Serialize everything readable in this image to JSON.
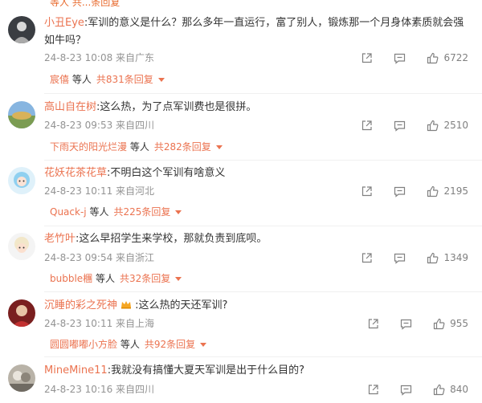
{
  "top_fragment": "等人 共...条回复",
  "comments": [
    {
      "user": "小丑Eye",
      "text": ":军训的意义是什么？那么多年一直运行，富了别人，锻炼那一个月身体素质就会强如牛吗？",
      "meta": "24-8-23 10:08 来自广东",
      "likes": "6722",
      "reply_user": "宸僖",
      "reply_mid": "等人",
      "reply_total": "共831条回复"
    },
    {
      "user": "高山自在树",
      "text": ":这么热，为了点军训费也是很拼。",
      "meta": "24-8-23 09:53 来自四川",
      "likes": "2510",
      "reply_user": "下雨天的阳光烂漫",
      "reply_mid": "等人",
      "reply_total": "共282条回复"
    },
    {
      "user": "花妖花茶花草",
      "text": ":不明白这个军训有啥意义",
      "meta": "24-8-23 10:11 来自河北",
      "likes": "2195",
      "reply_user": "Quack-j",
      "reply_mid": "等人",
      "reply_total": "共225条回复"
    },
    {
      "user": "老竹叶",
      "text": ":这么早招学生来学校，那就负责到底呗。",
      "meta": "24-8-23 09:54 来自浙江",
      "likes": "1349",
      "reply_user": "bubble檲",
      "reply_mid": "等人",
      "reply_total": "共32条回复"
    },
    {
      "user": "沉睡的彩之死神",
      "text": ":这么热的天还军训?",
      "meta": "24-8-23 10:11 来自上海",
      "likes": "955",
      "reply_user": "圆圆嘟嘟小方脸",
      "reply_mid": "等人",
      "reply_total": "共92条回复"
    },
    {
      "user": "MineMine11",
      "text": ":我就没有搞懂大夏天军训是出于什么目的?",
      "meta": "24-8-23 10:16 来自四川",
      "likes": "840"
    }
  ],
  "colors": {
    "username": "#eb7350",
    "meta": "#939393",
    "body": "#333333"
  }
}
